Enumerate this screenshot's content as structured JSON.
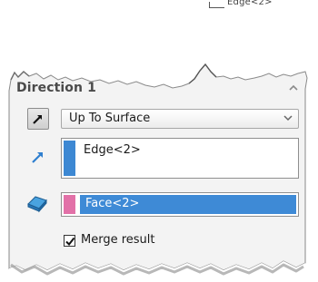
{
  "callout": {
    "label": "Edge<2>"
  },
  "panel": {
    "title": "Direction 1",
    "collapse_icon": "chevron-up-icon",
    "end_condition": {
      "selected": "Up To Surface",
      "icon": "direction-arrow-icon"
    },
    "edge_list": {
      "icon": "edge-direction-icon",
      "items": [
        "Edge<2>"
      ],
      "swatch_color": "#3d88d3"
    },
    "face_list": {
      "icon": "face-selection-icon",
      "items": [
        "Face<2>"
      ],
      "swatch_color": "#e271a8",
      "highlight_color": "#3e8ad6"
    },
    "merge_result": {
      "label": "Merge result",
      "checked": true
    }
  }
}
